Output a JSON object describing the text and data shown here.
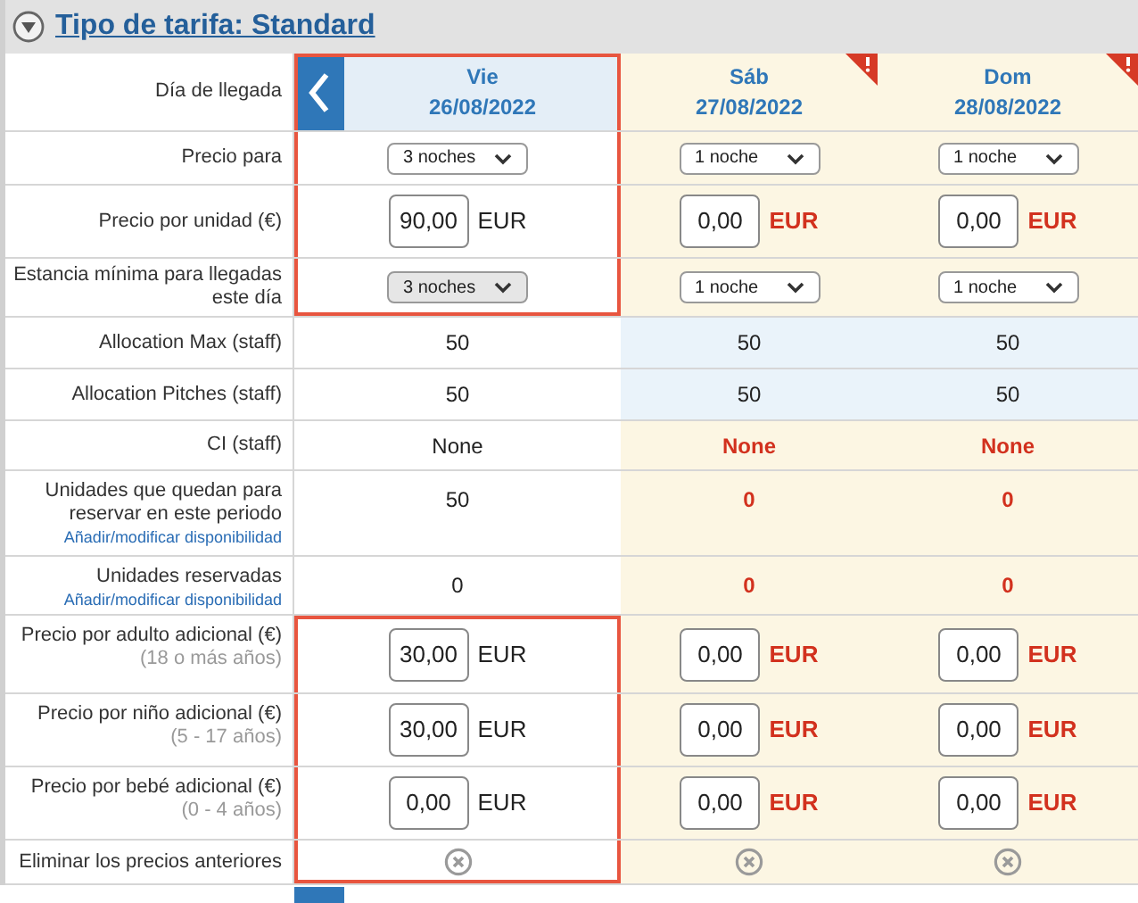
{
  "rate_type": {
    "title": "Tipo de tarifa: Standard",
    "expanded": true
  },
  "header_label": "Día de llegada",
  "rows": [
    {
      "label": "Precio para"
    },
    {
      "label": "Precio por unidad (€)"
    },
    {
      "label": "Estancia mínima para llegadas este día"
    },
    {
      "label": "Allocation Max (staff)"
    },
    {
      "label": "Allocation Pitches (staff)"
    },
    {
      "label": "CI (staff)"
    },
    {
      "label": "Unidades que quedan para reservar en este periodo",
      "link": "Añadir/modificar disponibilidad"
    },
    {
      "label": "Unidades reservadas",
      "link": "Añadir/modificar disponibilidad"
    },
    {
      "label": "Precio por adulto adicional (€)",
      "sublabel": "(18 o más años)"
    },
    {
      "label": "Precio por niño adicional (€)",
      "sublabel": "(5 - 17 años)"
    },
    {
      "label": "Precio por bebé adicional (€)",
      "sublabel": "(0 - 4 años)"
    },
    {
      "label": "Eliminar los precios anteriores"
    }
  ],
  "days": [
    {
      "weekday": "Vie",
      "date": "26/08/2022",
      "alert": false,
      "outlined": true,
      "cells": [
        {
          "kind": "select",
          "value": "3 noches",
          "disabled": false,
          "outlined": true
        },
        {
          "kind": "price",
          "value": "90,00",
          "currency": "EUR",
          "warning": false,
          "outlined": true
        },
        {
          "kind": "select",
          "value": "3 noches",
          "disabled": true,
          "outlined": true
        },
        {
          "kind": "number",
          "value": "50",
          "warning": false,
          "outlined": false
        },
        {
          "kind": "number",
          "value": "50",
          "warning": false,
          "outlined": false
        },
        {
          "kind": "number",
          "value": "None",
          "warning": false,
          "outlined": false
        },
        {
          "kind": "number",
          "value": "50",
          "warning": false,
          "outlined": false
        },
        {
          "kind": "number",
          "value": "0",
          "warning": false,
          "outlined": false
        },
        {
          "kind": "price",
          "value": "30,00",
          "currency": "EUR",
          "warning": false,
          "outlined": true
        },
        {
          "kind": "price",
          "value": "30,00",
          "currency": "EUR",
          "warning": false,
          "outlined": true
        },
        {
          "kind": "price",
          "value": "0,00",
          "currency": "EUR",
          "warning": false,
          "outlined": true
        },
        {
          "kind": "remove",
          "outlined": true
        }
      ]
    },
    {
      "weekday": "Sáb",
      "date": "27/08/2022",
      "alert": true,
      "outlined": false,
      "cells": [
        {
          "kind": "select",
          "value": "1 noche",
          "disabled": false,
          "outlined": false
        },
        {
          "kind": "price",
          "value": "0,00",
          "currency": "EUR",
          "warning": true,
          "outlined": false
        },
        {
          "kind": "select",
          "value": "1 noche",
          "disabled": false,
          "outlined": false
        },
        {
          "kind": "number",
          "value": "50",
          "warning": false,
          "outlined": false
        },
        {
          "kind": "number",
          "value": "50",
          "warning": false,
          "outlined": false
        },
        {
          "kind": "number",
          "value": "None",
          "warning": true,
          "outlined": false
        },
        {
          "kind": "number",
          "value": "0",
          "warning": true,
          "outlined": false
        },
        {
          "kind": "number",
          "value": "0",
          "warning": true,
          "outlined": false
        },
        {
          "kind": "price",
          "value": "0,00",
          "currency": "EUR",
          "warning": true,
          "outlined": false
        },
        {
          "kind": "price",
          "value": "0,00",
          "currency": "EUR",
          "warning": true,
          "outlined": false
        },
        {
          "kind": "price",
          "value": "0,00",
          "currency": "EUR",
          "warning": true,
          "outlined": false
        },
        {
          "kind": "remove",
          "outlined": false
        }
      ]
    },
    {
      "weekday": "Dom",
      "date": "28/08/2022",
      "alert": true,
      "outlined": false,
      "cells": [
        {
          "kind": "select",
          "value": "1 noche",
          "disabled": false,
          "outlined": false
        },
        {
          "kind": "price",
          "value": "0,00",
          "currency": "EUR",
          "warning": true,
          "outlined": false
        },
        {
          "kind": "select",
          "value": "1 noche",
          "disabled": false,
          "outlined": false
        },
        {
          "kind": "number",
          "value": "50",
          "warning": false,
          "outlined": false
        },
        {
          "kind": "number",
          "value": "50",
          "warning": false,
          "outlined": false
        },
        {
          "kind": "number",
          "value": "None",
          "warning": true,
          "outlined": false
        },
        {
          "kind": "number",
          "value": "0",
          "warning": true,
          "outlined": false
        },
        {
          "kind": "number",
          "value": "0",
          "warning": true,
          "outlined": false
        },
        {
          "kind": "price",
          "value": "0,00",
          "currency": "EUR",
          "warning": true,
          "outlined": false
        },
        {
          "kind": "price",
          "value": "0,00",
          "currency": "EUR",
          "warning": true,
          "outlined": false
        },
        {
          "kind": "price",
          "value": "0,00",
          "currency": "EUR",
          "warning": true,
          "outlined": false
        },
        {
          "kind": "remove",
          "outlined": false
        }
      ]
    }
  ]
}
